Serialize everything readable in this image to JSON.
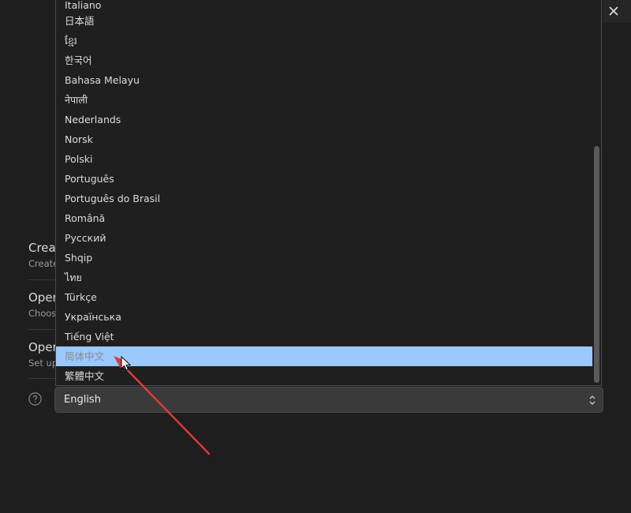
{
  "window": {
    "close_icon": "close-icon"
  },
  "background": {
    "items": [
      {
        "title": "Creat",
        "subtitle": "Create"
      },
      {
        "title": "Oper",
        "subtitle": "Choos"
      },
      {
        "title": "Oper",
        "subtitle": "Set up"
      }
    ],
    "help_icon": "help-circle-icon"
  },
  "language_dropdown": {
    "options": [
      {
        "label": "Italiano"
      },
      {
        "label": "日本語"
      },
      {
        "label": "ខ្មែរ"
      },
      {
        "label": "한국어"
      },
      {
        "label": "Bahasa Melayu"
      },
      {
        "label": "नेपाली"
      },
      {
        "label": "Nederlands"
      },
      {
        "label": "Norsk"
      },
      {
        "label": "Polski"
      },
      {
        "label": "Português"
      },
      {
        "label": "Português do Brasil"
      },
      {
        "label": "Română"
      },
      {
        "label": "Русский"
      },
      {
        "label": "Shqip"
      },
      {
        "label": "ไทย"
      },
      {
        "label": "Türkçe"
      },
      {
        "label": "Українська"
      },
      {
        "label": "Tiếng Việt"
      },
      {
        "label": "简体中文"
      },
      {
        "label": "繁體中文"
      }
    ],
    "highlighted_index": 18
  },
  "language_select": {
    "value": "English",
    "arrows_icon": "chevron-up-down-icon"
  },
  "colors": {
    "background": "#1e1e1e",
    "highlight": "#99c9ff",
    "annotation_arrow": "#e03a3a"
  }
}
